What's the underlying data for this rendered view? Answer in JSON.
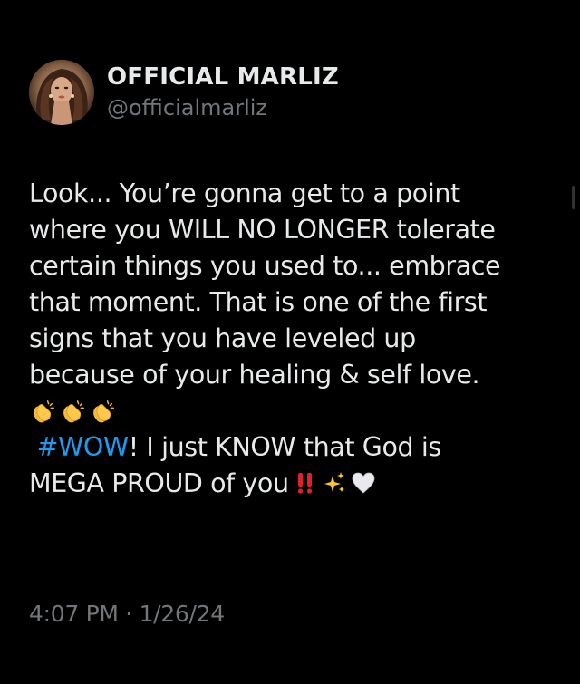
{
  "tweet": {
    "author": {
      "display_name": "OFFICIAL MARLIZ",
      "handle": "@officialmarliz",
      "avatar_icon": "profile-photo"
    },
    "text_lines": [
      "Look... You’re gonna get to a point",
      "where you WILL NO LONGER tolerate",
      "certain things you used to... embrace",
      "that moment. That is one of the first",
      "signs that you have leveled up",
      "because of your healing & self love."
    ],
    "emoji_row": [
      "clapping-hands-icon",
      "clapping-hands-icon",
      "clapping-hands-icon"
    ],
    "hashtag": "#WOW",
    "after_hashtag": "! I just KNOW that God is",
    "last_line_text": "MEGA PROUD of you",
    "trailing_emojis": [
      "double-exclamation-icon",
      "sparkles-icon",
      "white-heart-icon"
    ],
    "timestamp": "4:07 PM · 1/26/24"
  },
  "colors": {
    "background": "#000000",
    "primary_text": "#e7e9ea",
    "secondary_text": "#71767b",
    "link": "#1d9bf0"
  }
}
